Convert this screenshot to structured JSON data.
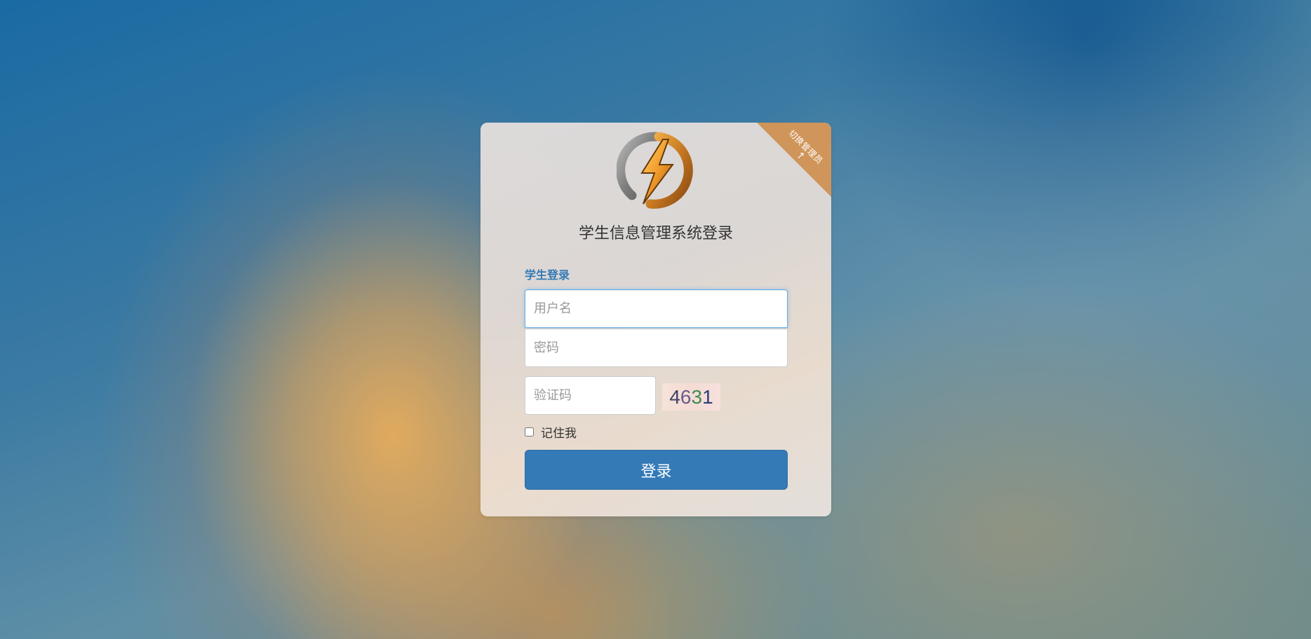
{
  "corner_ribbon": {
    "label": "切换管理员",
    "arrow": "↑"
  },
  "system_title": "学生信息管理系统登录",
  "section_label": "学生登录",
  "form": {
    "username_placeholder": "用户名",
    "password_placeholder": "密码",
    "captcha_placeholder": "验证码",
    "captcha_digits": [
      "4",
      "6",
      "3",
      "1"
    ],
    "captcha_colors": [
      "#3a3f66",
      "#6b5a8a",
      "#3f8a4f",
      "#2b3f7a"
    ],
    "remember_label": "记住我",
    "login_label": "登录"
  },
  "colors": {
    "primary": "#337ab7",
    "ribbon": "#d0955a"
  },
  "icons": {
    "logo": "lightning-bolt-logo-icon",
    "ribbon_arrow": "arrow-up-icon"
  }
}
